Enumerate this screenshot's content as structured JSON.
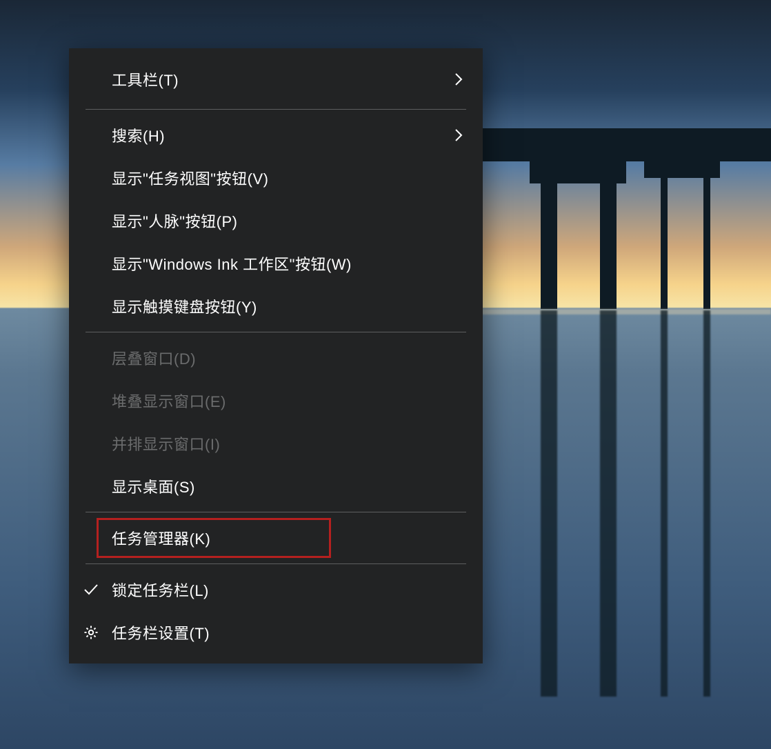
{
  "menu": {
    "groups": [
      [
        {
          "id": "toolbars",
          "label": "工具栏(T)",
          "submenu": true,
          "disabled": false,
          "icon": null,
          "highlighted": false
        }
      ],
      [
        {
          "id": "search",
          "label": "搜索(H)",
          "submenu": true,
          "disabled": false,
          "icon": null,
          "highlighted": false
        },
        {
          "id": "show-task-view",
          "label": "显示\"任务视图\"按钮(V)",
          "submenu": false,
          "disabled": false,
          "icon": null,
          "highlighted": false
        },
        {
          "id": "show-people",
          "label": "显示\"人脉\"按钮(P)",
          "submenu": false,
          "disabled": false,
          "icon": null,
          "highlighted": false
        },
        {
          "id": "show-ink",
          "label": "显示\"Windows Ink 工作区\"按钮(W)",
          "submenu": false,
          "disabled": false,
          "icon": null,
          "highlighted": false
        },
        {
          "id": "show-touch-kb",
          "label": "显示触摸键盘按钮(Y)",
          "submenu": false,
          "disabled": false,
          "icon": null,
          "highlighted": false
        }
      ],
      [
        {
          "id": "cascade",
          "label": "层叠窗口(D)",
          "submenu": false,
          "disabled": true,
          "icon": null,
          "highlighted": false
        },
        {
          "id": "stack",
          "label": "堆叠显示窗口(E)",
          "submenu": false,
          "disabled": true,
          "icon": null,
          "highlighted": false
        },
        {
          "id": "side-by-side",
          "label": "并排显示窗口(I)",
          "submenu": false,
          "disabled": true,
          "icon": null,
          "highlighted": false
        },
        {
          "id": "show-desktop",
          "label": "显示桌面(S)",
          "submenu": false,
          "disabled": false,
          "icon": null,
          "highlighted": false
        }
      ],
      [
        {
          "id": "task-manager",
          "label": "任务管理器(K)",
          "submenu": false,
          "disabled": false,
          "icon": null,
          "highlighted": true
        }
      ],
      [
        {
          "id": "lock-taskbar",
          "label": "锁定任务栏(L)",
          "submenu": false,
          "disabled": false,
          "icon": "check",
          "highlighted": false
        },
        {
          "id": "taskbar-settings",
          "label": "任务栏设置(T)",
          "submenu": false,
          "disabled": false,
          "icon": "gear",
          "highlighted": false
        }
      ]
    ]
  },
  "colors": {
    "menu_bg": "#222324",
    "menu_text": "#ffffff",
    "menu_disabled": "#6b6c6d",
    "separator": "#5e5f60",
    "highlight_border": "#b5201f"
  }
}
